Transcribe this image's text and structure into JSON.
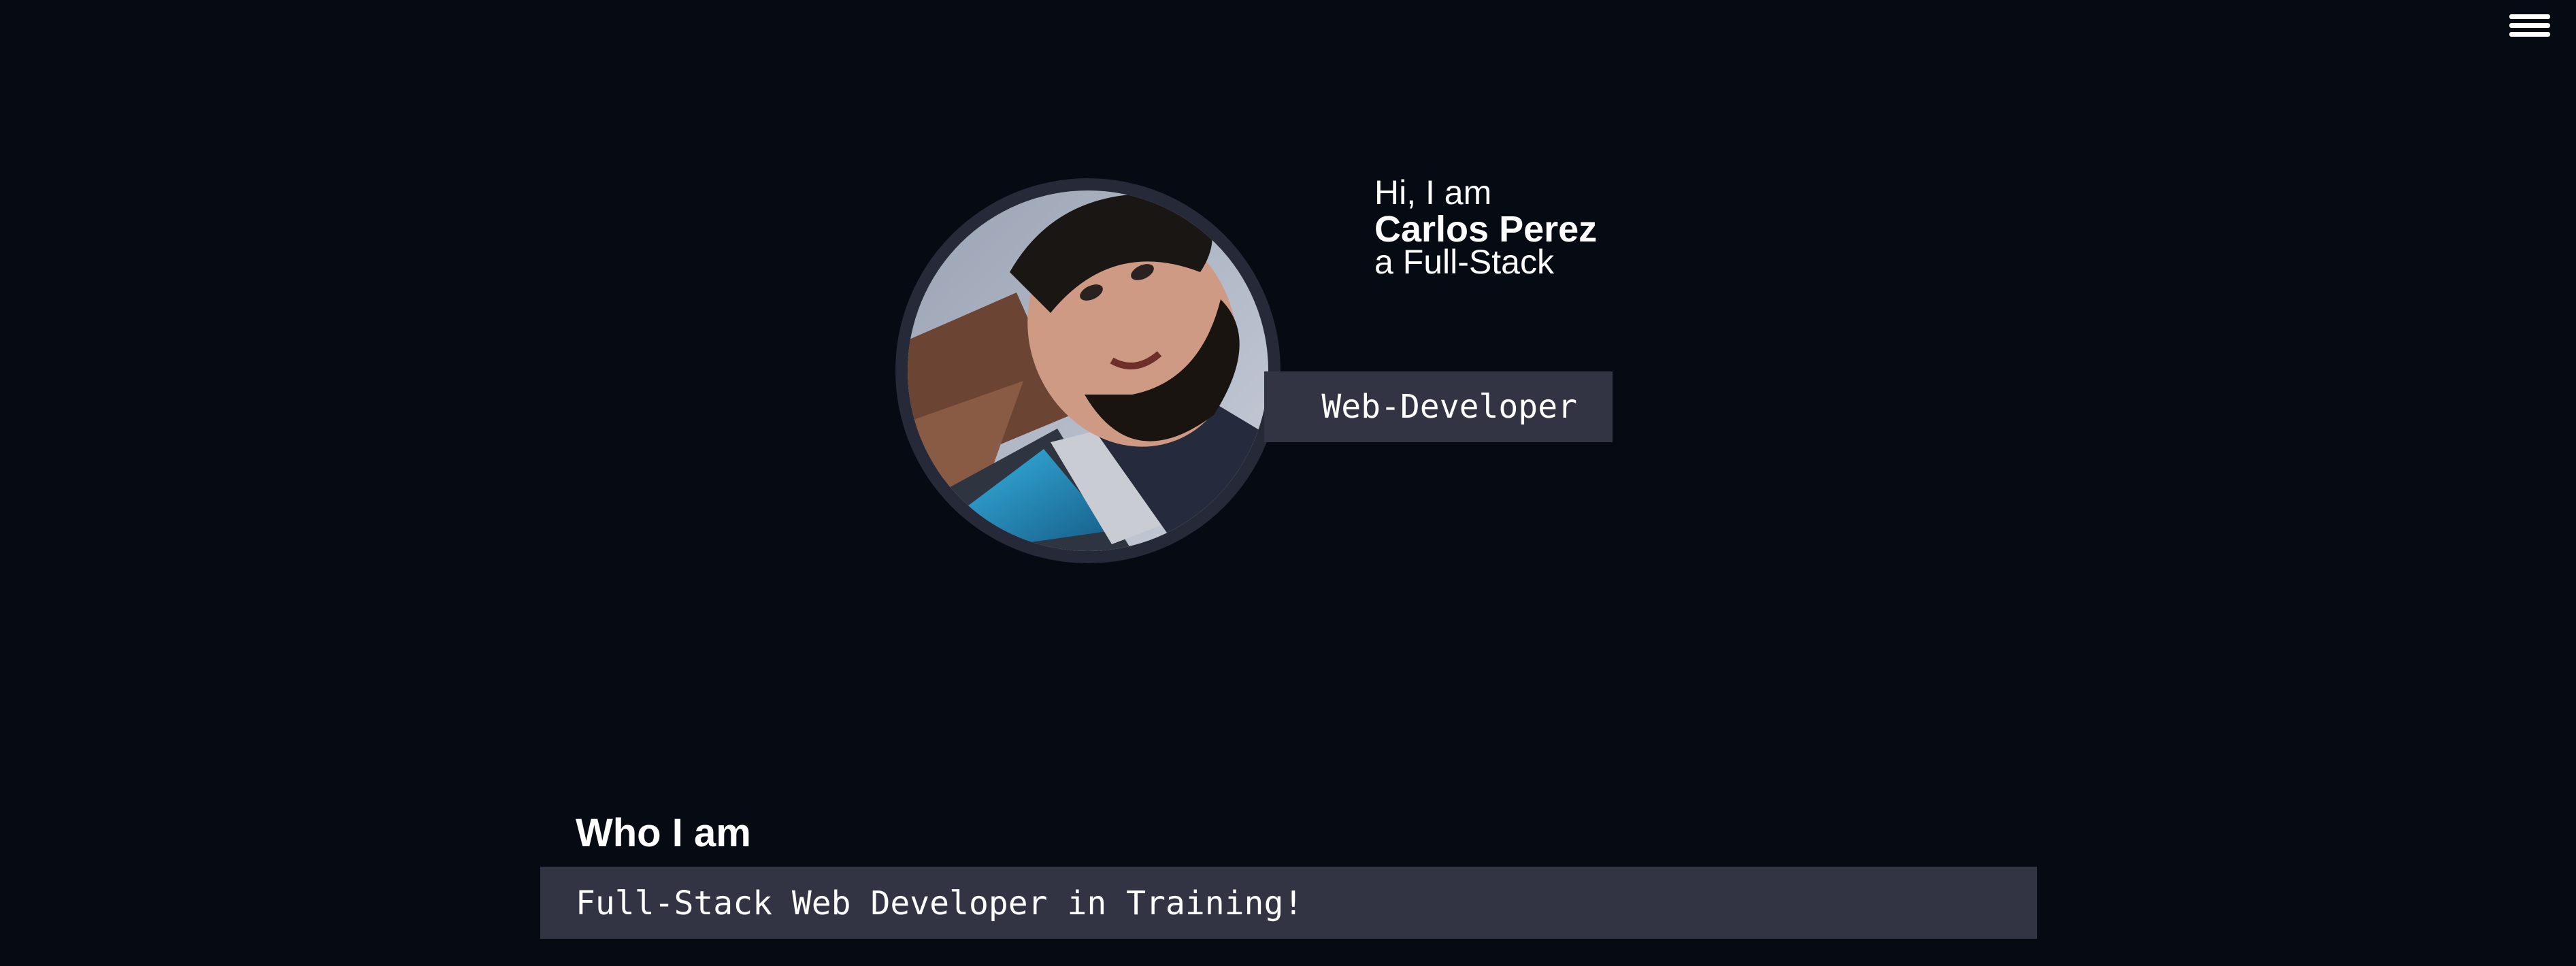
{
  "navigation": {
    "menu_icon": "hamburger-menu-icon"
  },
  "profile": {
    "photo_description": "profile-photo",
    "greeting": "Hi, I am",
    "name": "Carlos Perez",
    "role_prefix": "a Full-Stack",
    "role_badge": "Web-Developer"
  },
  "about": {
    "title": "Who I am",
    "summary": "Full-Stack Web Developer in Training!"
  },
  "colors": {
    "background": "#050a13",
    "panel": "#323444",
    "avatar_ring": "#262a38",
    "text": "#ffffff"
  }
}
